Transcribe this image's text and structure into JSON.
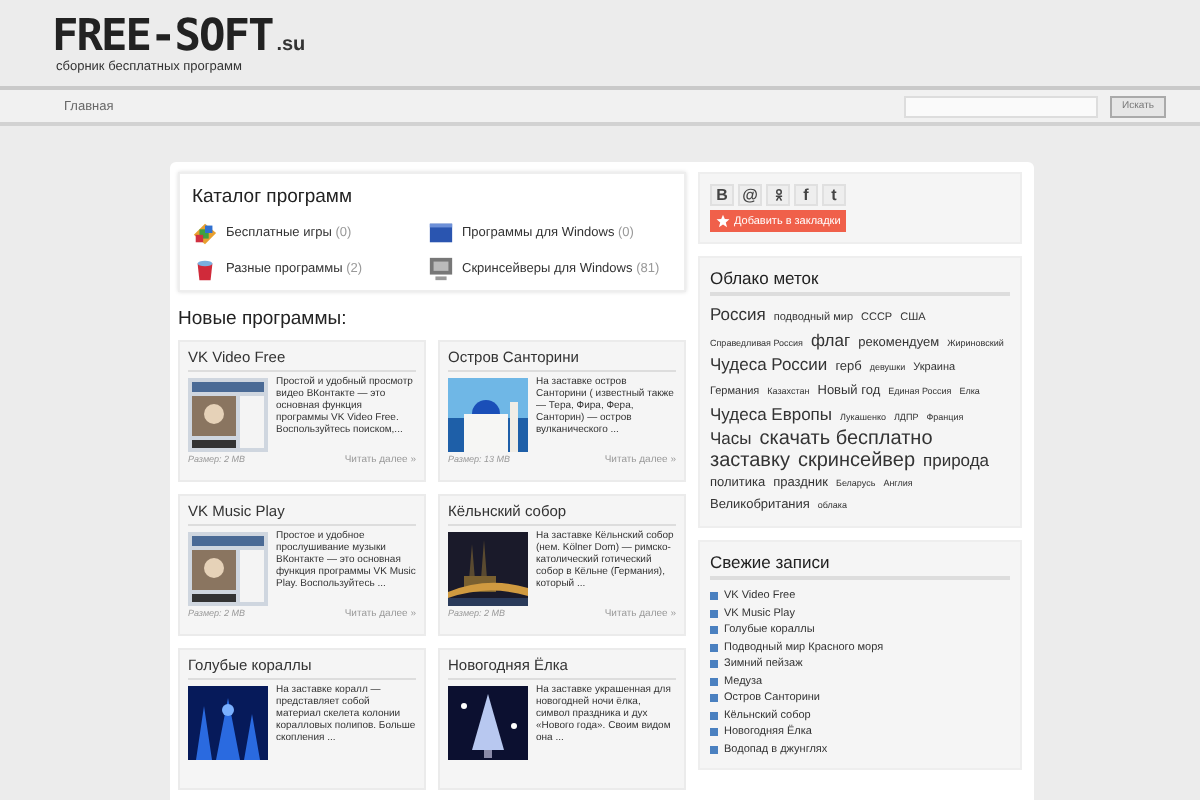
{
  "logo": {
    "name": "FREE-SOFT",
    "tld": ".su",
    "tagline": "сборник бесплатных программ"
  },
  "nav": {
    "items": [
      {
        "label": "Главная"
      }
    ],
    "search_button": "Искать"
  },
  "catalog": {
    "title": "Каталог программ",
    "items": [
      {
        "label": "Бесплатные игры",
        "count": "(0)"
      },
      {
        "label": "Программы для Windows",
        "count": "(0)"
      },
      {
        "label": "Разные программы",
        "count": "(2)"
      },
      {
        "label": "Скринсейверы для Windows",
        "count": "(81)"
      }
    ]
  },
  "new_title": "Новые программы:",
  "cards": [
    {
      "title": "VK Video Free",
      "text": "Простой и удобный просмотр видео ВКонтакте — это основная функция программы VK Video Free. Воспользуйтесь поиском,...",
      "size": "Размер: 2 MB",
      "more": "Читать далее »"
    },
    {
      "title": "Остров Санторини",
      "text": "На заставке остров Санторини ( известный также — Тера, Фира, Фера, Санторин) — остров вулканического ...",
      "size": "Размер: 13 MB",
      "more": "Читать далее »"
    },
    {
      "title": "VK Music Play",
      "text": "Простое и удобное прослушивание музыки ВКонтакте — это основная функция программы VK Music Play. Воспользуйтесь ...",
      "size": "Размер: 2 MB",
      "more": "Читать далее »"
    },
    {
      "title": "Кёльнский собор",
      "text": "На заставке Кёльнский собор (нем. Kölner Dom) — римско-католический готический собор в Кёльне (Германия), который ...",
      "size": "Размер: 2 MB",
      "more": "Читать далее »"
    },
    {
      "title": "Голубые кораллы",
      "text": "На заставке коралл — представляет собой материал скелета колонии коралловых полипов. Больше скопления ..."
    },
    {
      "title": "Новогодняя Ёлка",
      "text": "На заставке украшенная для новогодней ночи ёлка, символ праздника и дух «Нового года». Своим видом она ..."
    }
  ],
  "social": {
    "buttons": [
      {
        "kind": "text",
        "label": "В"
      },
      {
        "kind": "text",
        "label": "@"
      },
      {
        "kind": "icon"
      },
      {
        "kind": "text",
        "label": "f"
      },
      {
        "kind": "text",
        "label": "t"
      }
    ],
    "bookmark": "Добавить в закладки"
  },
  "tag_cloud": {
    "title": "Облако меток",
    "tags": [
      {
        "label": "Россия",
        "kind": "large"
      },
      {
        "label": "подводный мир",
        "kind": "small"
      },
      {
        "label": "СССР",
        "kind": "small"
      },
      {
        "label": "США",
        "kind": "small"
      },
      {
        "label": "Справедливая Россия",
        "kind": "tiny"
      },
      {
        "label": "флаг",
        "kind": "large"
      },
      {
        "label": "рекомендуем",
        "kind": "medium"
      },
      {
        "label": "Жириновский",
        "kind": "tiny"
      },
      {
        "label": "Чудеса России",
        "kind": "large"
      },
      {
        "label": "герб",
        "kind": "medium"
      },
      {
        "label": "девушки",
        "kind": "tiny"
      },
      {
        "label": "Украина",
        "kind": "small"
      },
      {
        "label": "Германия",
        "kind": "small"
      },
      {
        "label": "Казахстан",
        "kind": "tiny"
      },
      {
        "label": "Новый год",
        "kind": "medium"
      },
      {
        "label": "Единая Россия",
        "kind": "tiny"
      },
      {
        "label": "Елка",
        "kind": "tiny"
      },
      {
        "label": "Чудеса Европы",
        "kind": "large"
      },
      {
        "label": "Лукашенко",
        "kind": "tiny"
      },
      {
        "label": "ЛДПР",
        "kind": "tiny"
      },
      {
        "label": "Франция",
        "kind": "tiny"
      },
      {
        "label": "Часы",
        "kind": "large"
      },
      {
        "label": "скачать бесплатно",
        "kind": "huge"
      },
      {
        "label": "заставку",
        "kind": "huge"
      },
      {
        "label": "скринсейвер",
        "kind": "huge"
      },
      {
        "label": "природа",
        "kind": "large"
      },
      {
        "label": "политика",
        "kind": "medium"
      },
      {
        "label": "праздник",
        "kind": "medium"
      },
      {
        "label": "Беларусь",
        "kind": "tiny"
      },
      {
        "label": "Англия",
        "kind": "tiny"
      },
      {
        "label": "Великобритания",
        "kind": "medium"
      },
      {
        "label": "облака",
        "kind": "tiny"
      }
    ]
  },
  "fresh": {
    "title": "Свежие записи",
    "items": [
      "VK Video Free",
      "VK Music Play",
      "Голубые кораллы",
      "Подводный мир Красного моря",
      "Зимний пейзаж",
      "Медуза",
      "Остров Санторини",
      "Кёльнский собор",
      "Новогодняя Ёлка",
      "Водопад в джунглях"
    ]
  }
}
